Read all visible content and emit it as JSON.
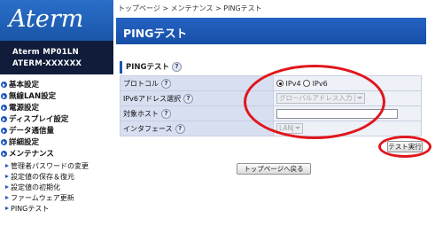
{
  "sidebar": {
    "logo": "Aterm",
    "model_line1": "Aterm   MP01LN",
    "model_line2": "ATERM-XXXXXX",
    "items": [
      {
        "label": "基本設定"
      },
      {
        "label": "無線LAN設定"
      },
      {
        "label": "電源設定"
      },
      {
        "label": "ディスプレイ設定"
      },
      {
        "label": "データ通信量"
      },
      {
        "label": "詳細設定"
      },
      {
        "label": "メンテナンス"
      }
    ],
    "subitems": [
      {
        "label": "管理者パスワードの変更"
      },
      {
        "label": "設定値の保存＆復元"
      },
      {
        "label": "設定値の初期化"
      },
      {
        "label": "ファームウェア更新"
      },
      {
        "label": "PINGテスト"
      }
    ]
  },
  "breadcrumb": "トップページ > メンテナンス > PINGテスト",
  "page_title": "PINGテスト",
  "section": {
    "title": "PINGテスト",
    "help": "?"
  },
  "form": {
    "protocol": {
      "label": "プロトコル",
      "help": "?",
      "option1": "IPv4",
      "option2": "IPv6",
      "selected": "IPv4"
    },
    "ipv6_select": {
      "label": "IPv6アドレス選択",
      "help": "?",
      "value": "グローバルアドレス入力"
    },
    "target_host": {
      "label": "対象ホスト",
      "help": "?",
      "value": ""
    },
    "interface": {
      "label": "インタフェース",
      "help": "?",
      "value": "LAN"
    }
  },
  "buttons": {
    "run_test": "テスト実行",
    "back_top": "トップページへ戻る"
  },
  "colors": {
    "header_blue": "#1a55b8",
    "model_box": "#101c3a",
    "label_cell": "#d8dff0",
    "annotation_red": "#e0161c"
  }
}
